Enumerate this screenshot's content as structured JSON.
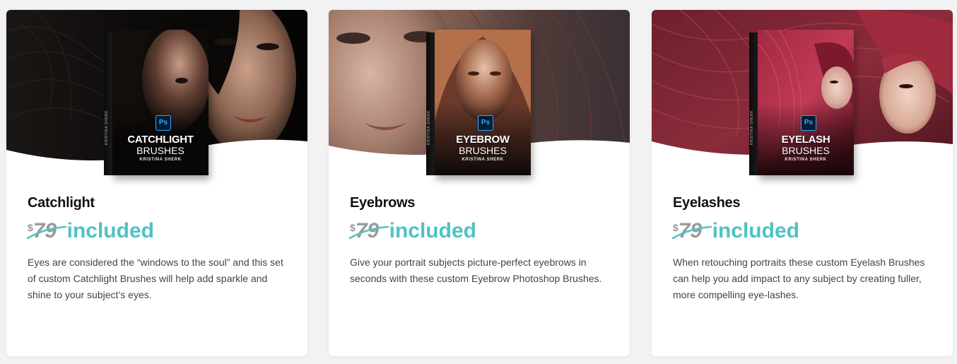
{
  "cards": [
    {
      "title": "Catchlight",
      "old_price_currency": "$",
      "old_price_amount": "79",
      "included_label": "included",
      "description": "Eyes are considered the “windows to the soul” and this set of custom Catchlight Brushes will help add sparkle and shine to your subject’s eyes.",
      "product_box": {
        "badge": "Ps",
        "title_line1": "CATCHLIGHT",
        "title_line2": "BRUSHES",
        "author": "KRISTINA SHERK",
        "spine": "KRISTINA SHERK"
      }
    },
    {
      "title": "Eyebrows",
      "old_price_currency": "$",
      "old_price_amount": "79",
      "included_label": "included",
      "description": "Give your portrait subjects picture-perfect eyebrows in seconds with these custom Eyebrow Photoshop Brushes.",
      "product_box": {
        "badge": "Ps",
        "title_line1": "EYEBROW",
        "title_line2": "BRUSHES",
        "author": "KRISTINA SHERK",
        "spine": "KRISTINA SHERK"
      }
    },
    {
      "title": "Eyelashes",
      "old_price_currency": "$",
      "old_price_amount": "79",
      "included_label": "included",
      "description": "When retouching portraits these custom Eyelash Brushes can help you add impact to any subject by creating fuller, more compelling eye-lashes.",
      "product_box": {
        "badge": "Ps",
        "title_line1": "EYELASH",
        "title_line2": "BRUSHES",
        "author": "KRISTINA SHERK",
        "spine": "KRISTINA SHERK"
      }
    }
  ],
  "colors": {
    "accent": "#4fc3c3",
    "old_price": "#9a9a9a",
    "title": "#111111",
    "body_text": "#444444",
    "page_bg": "#f2f2f3",
    "card_bg": "#ffffff"
  }
}
